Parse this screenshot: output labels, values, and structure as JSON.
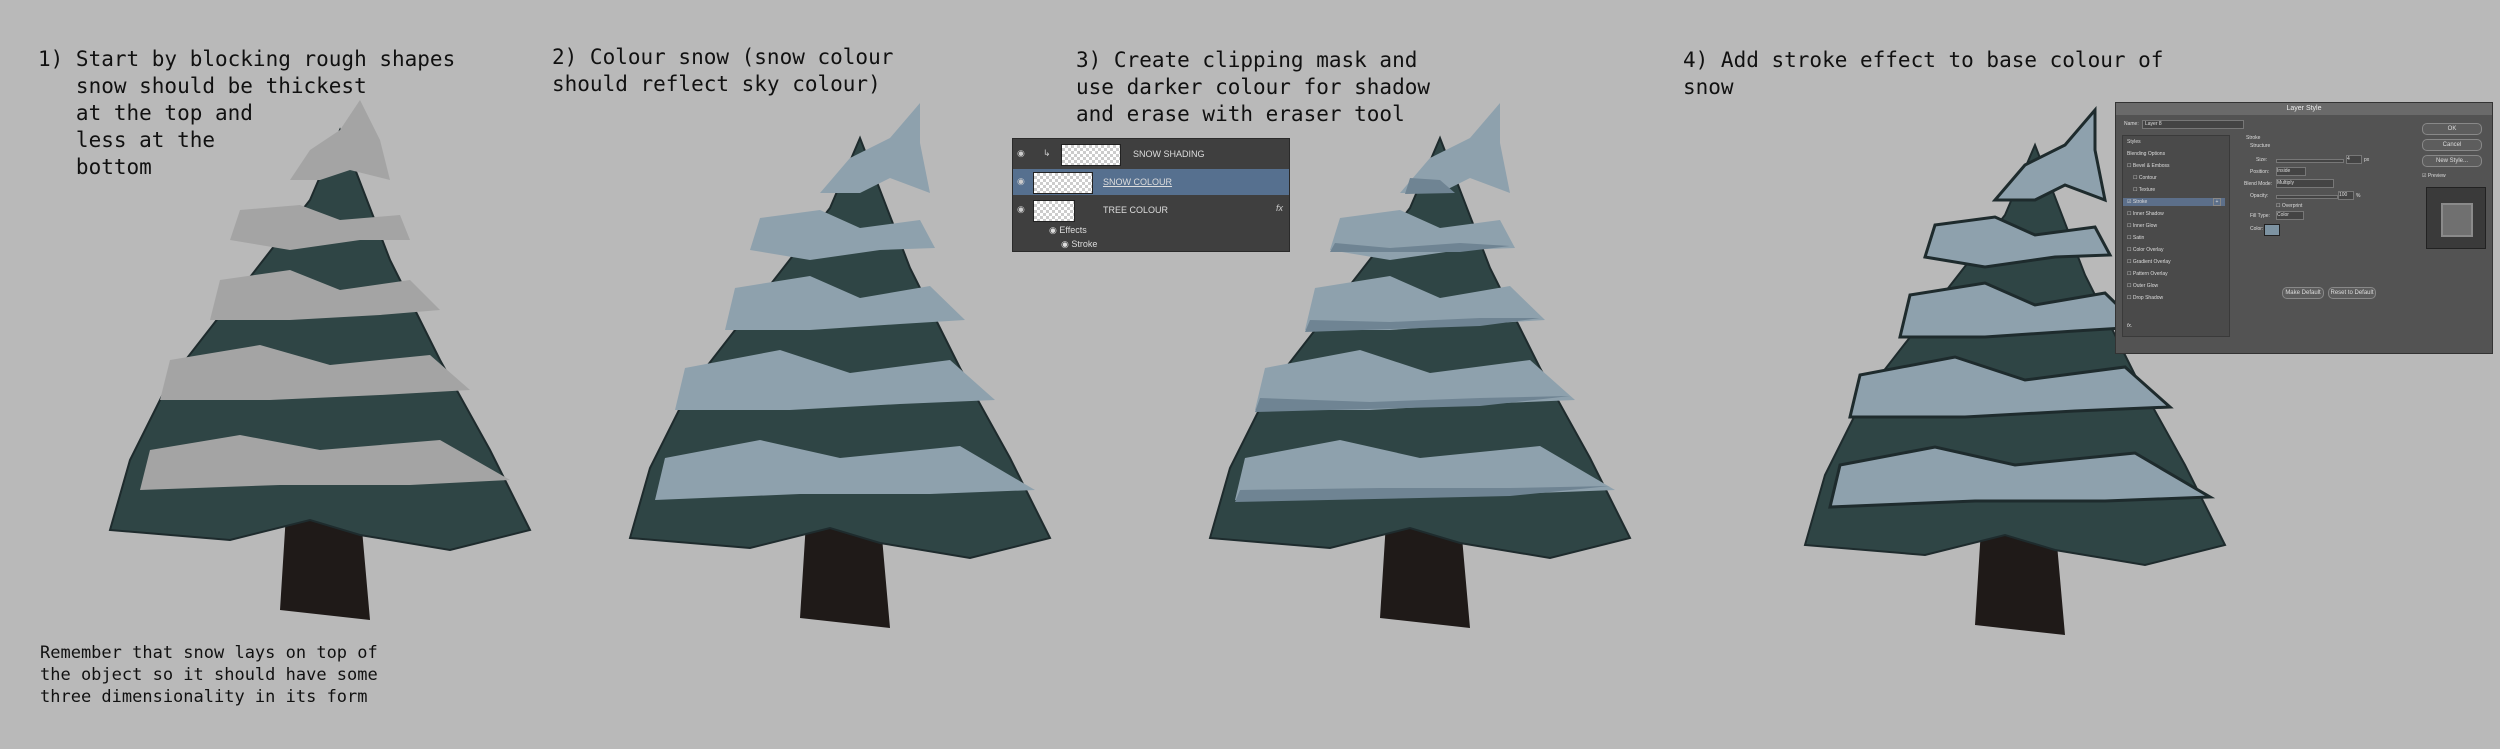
{
  "steps": [
    {
      "lines": [
        "1) Start by blocking rough shapes",
        "   snow should be thickest",
        "   at the top and",
        "   less at the",
        "   bottom"
      ]
    },
    {
      "lines": [
        "2) Colour snow (snow colour",
        "should reflect sky colour)"
      ]
    },
    {
      "lines": [
        "3) Create clipping mask and",
        "use darker colour for shadow",
        "and erase with eraser tool"
      ]
    },
    {
      "lines": [
        "4) Add stroke effect to base colour of",
        "snow"
      ]
    }
  ],
  "note": {
    "lines": [
      "Remember that snow lays on top of",
      "the object so it should have some",
      "three dimensionality in its form"
    ]
  },
  "layers_panel": {
    "layers": [
      {
        "name": "SNOW SHADING",
        "selected": false,
        "clipped": true
      },
      {
        "name": "SNOW COLOUR",
        "selected": true,
        "clipped": false
      },
      {
        "name": "TREE COLOUR",
        "selected": false,
        "clipped": false,
        "fx": "fx"
      }
    ],
    "effects_label": "Effects",
    "stroke_label": "Stroke"
  },
  "layer_style_dialog": {
    "title": "Layer Style",
    "name_label": "Name:",
    "name_value": "Layer 8",
    "styles_heading": "Styles",
    "styles": [
      "Blending Options",
      "Bevel & Emboss",
      "Contour",
      "Texture",
      "Stroke",
      "Inner Shadow",
      "Inner Glow",
      "Satin",
      "Color Overlay",
      "Gradient Overlay",
      "Pattern Overlay",
      "Outer Glow",
      "Drop Shadow"
    ],
    "active_style": "Stroke",
    "section_title": "Stroke",
    "structure_label": "Structure",
    "size_label": "Size:",
    "size_value": "4",
    "size_unit": "px",
    "position_label": "Position:",
    "position_value": "Inside",
    "blend_mode_label": "Blend Mode:",
    "blend_mode_value": "Multiply",
    "opacity_label": "Opacity:",
    "opacity_value": "100",
    "opacity_unit": "%",
    "overprint_label": "Overprint",
    "fill_type_label": "Fill Type:",
    "fill_type_value": "Color",
    "color_label": "Color:",
    "make_default_label": "Make Default",
    "reset_default_label": "Reset to Default",
    "ok_label": "OK",
    "cancel_label": "Cancel",
    "new_style_label": "New Style...",
    "preview_label": "Preview",
    "fx_footer": "fx."
  },
  "colors": {
    "background": "#b9b9b9",
    "trunk": "#1f1a18",
    "foliage": "#2f4545",
    "snow_grey": "#a4a4a4",
    "snow_blue": "#8ea1ad",
    "snow_shadow": "#6f8493",
    "stroke": "#1e2b2d",
    "panel": "#3f3f3f",
    "selected_layer": "#56708f"
  }
}
